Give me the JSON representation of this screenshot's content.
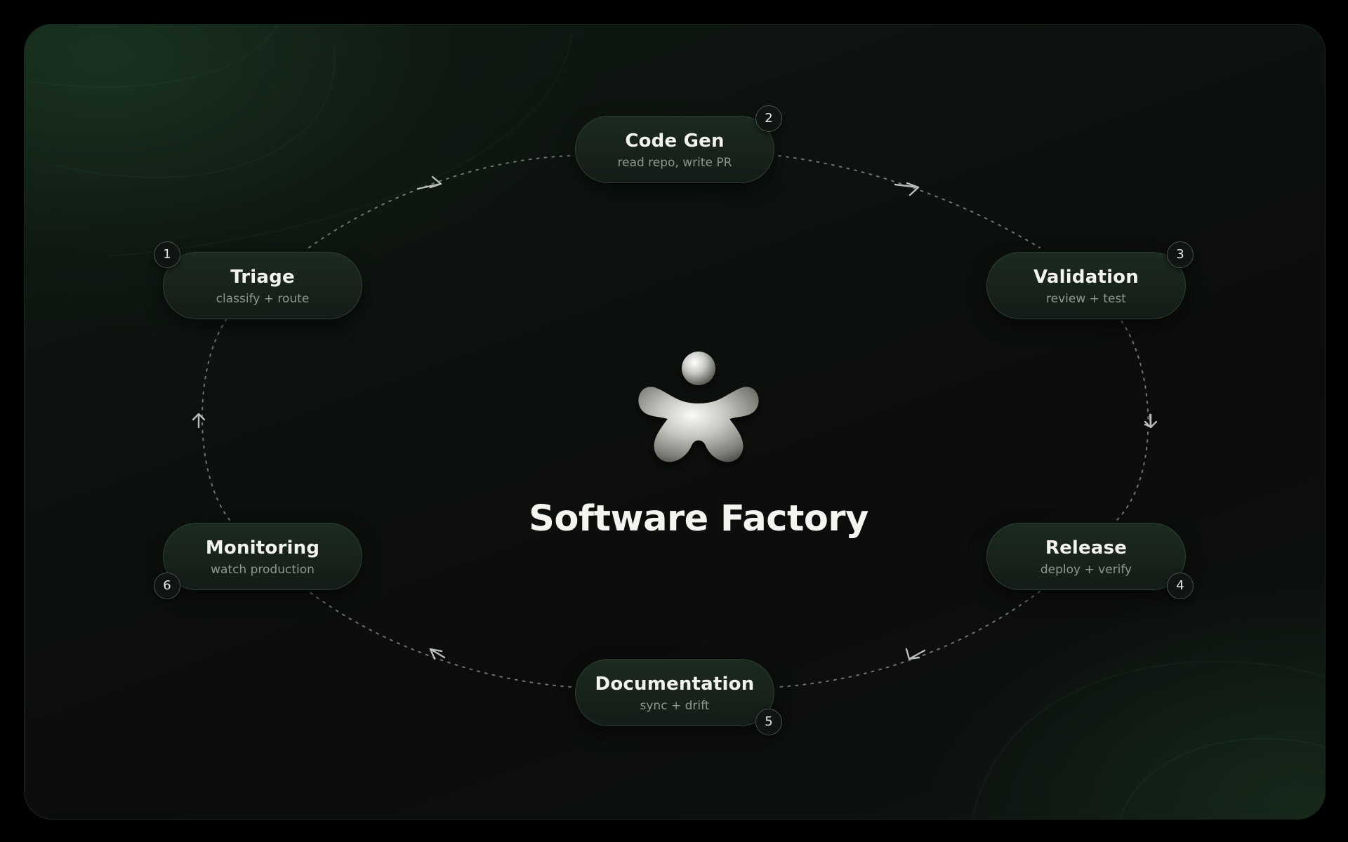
{
  "diagram": {
    "title": "Software Factory",
    "logo_icon": "starfish-figure-icon",
    "steps": [
      {
        "number": "1",
        "title": "Triage",
        "subtitle": "classify + route"
      },
      {
        "number": "2",
        "title": "Code Gen",
        "subtitle": "read repo, write PR"
      },
      {
        "number": "3",
        "title": "Validation",
        "subtitle": "review + test"
      },
      {
        "number": "4",
        "title": "Release",
        "subtitle": "deploy + verify"
      },
      {
        "number": "5",
        "title": "Documentation",
        "subtitle": "sync + drift"
      },
      {
        "number": "6",
        "title": "Monitoring",
        "subtitle": "watch production"
      }
    ],
    "flow": "clockwise",
    "colors": {
      "background": "#0b0e0c",
      "glow": "#1e3e26",
      "node_fill": "#18241b",
      "node_border": "#2e3f33",
      "text": "#f2f2ee",
      "subtext": "#8f968f",
      "connector": "#6e746f"
    }
  }
}
